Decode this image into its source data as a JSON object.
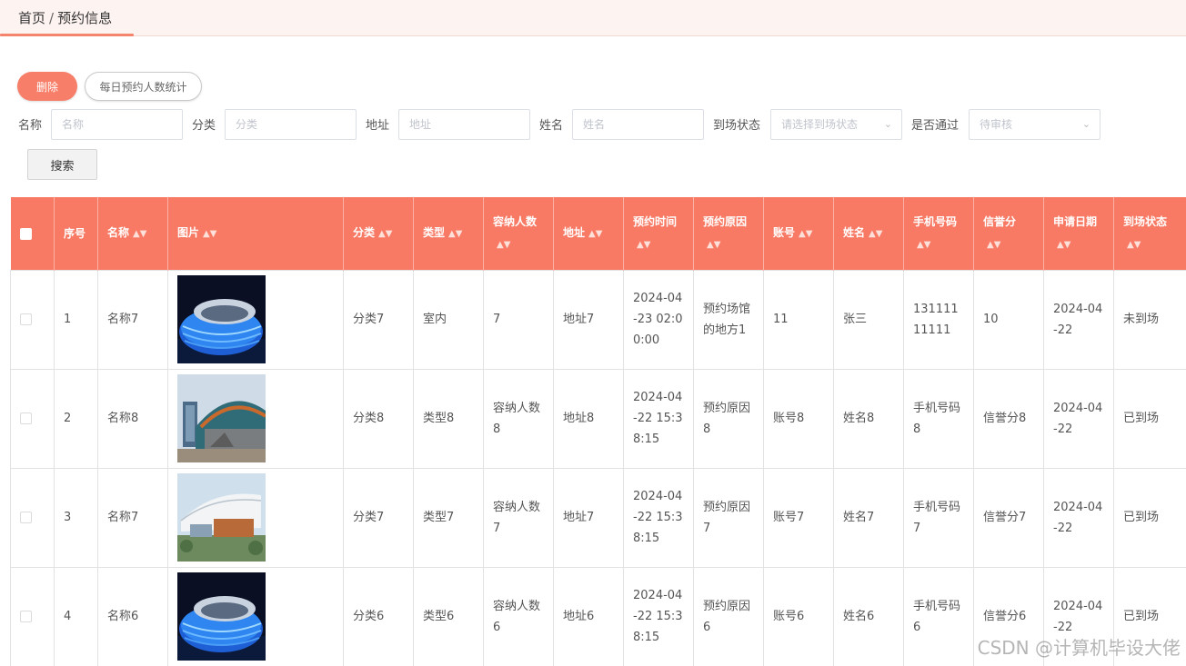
{
  "breadcrumb": {
    "home": "首页",
    "separator": "/",
    "current": "预约信息"
  },
  "actions": {
    "delete_label": "删除",
    "stats_label": "每日预约人数统计",
    "search_label": "搜索"
  },
  "filters": {
    "name": {
      "label": "名称",
      "placeholder": "名称"
    },
    "category": {
      "label": "分类",
      "placeholder": "分类"
    },
    "address": {
      "label": "地址",
      "placeholder": "地址"
    },
    "person": {
      "label": "姓名",
      "placeholder": "姓名"
    },
    "arrival": {
      "label": "到场状态",
      "placeholder": "请选择到场状态"
    },
    "approved": {
      "label": "是否通过",
      "placeholder": "待审核"
    }
  },
  "colors": {
    "accent": "#f87a64",
    "header_bg": "#fdf3f1"
  },
  "table": {
    "headers": [
      "序号",
      "名称",
      "图片",
      "分类",
      "类型",
      "容纳人数",
      "地址",
      "预约时间",
      "预约原因",
      "账号",
      "姓名",
      "手机号码",
      "信誉分",
      "申请日期",
      "到场状态"
    ],
    "rows": [
      {
        "index": "1",
        "name": "名称7",
        "image": "stadium-night-blue",
        "category": "分类7",
        "type": "室内",
        "capacity": "7",
        "address": "地址7",
        "time": "2024-04-23 02:00:00",
        "reason": "预约场馆的地方1",
        "account": "11",
        "person": "张三",
        "phone": "13111111111",
        "credit": "10",
        "date": "2024-04-22",
        "status": "未到场"
      },
      {
        "index": "2",
        "name": "名称8",
        "image": "stadium-day-teal",
        "category": "分类8",
        "type": "类型8",
        "capacity": "容纳人数8",
        "address": "地址8",
        "time": "2024-04-22 15:38:15",
        "reason": "预约原因8",
        "account": "账号8",
        "person": "姓名8",
        "phone": "手机号码8",
        "credit": "信誉分8",
        "date": "2024-04-22",
        "status": "已到场"
      },
      {
        "index": "3",
        "name": "名称7",
        "image": "stadium-white-roof",
        "category": "分类7",
        "type": "类型7",
        "capacity": "容纳人数7",
        "address": "地址7",
        "time": "2024-04-22 15:38:15",
        "reason": "预约原因7",
        "account": "账号7",
        "person": "姓名7",
        "phone": "手机号码7",
        "credit": "信誉分7",
        "date": "2024-04-22",
        "status": "已到场"
      },
      {
        "index": "4",
        "name": "名称6",
        "image": "stadium-night-blue",
        "category": "分类6",
        "type": "类型6",
        "capacity": "容纳人数6",
        "address": "地址6",
        "time": "2024-04-22 15:38:15",
        "reason": "预约原因6",
        "account": "账号6",
        "person": "姓名6",
        "phone": "手机号码6",
        "credit": "信誉分6",
        "date": "2024-04-22",
        "status": "已到场"
      }
    ]
  },
  "watermark": "CSDN @计算机毕设大佬"
}
